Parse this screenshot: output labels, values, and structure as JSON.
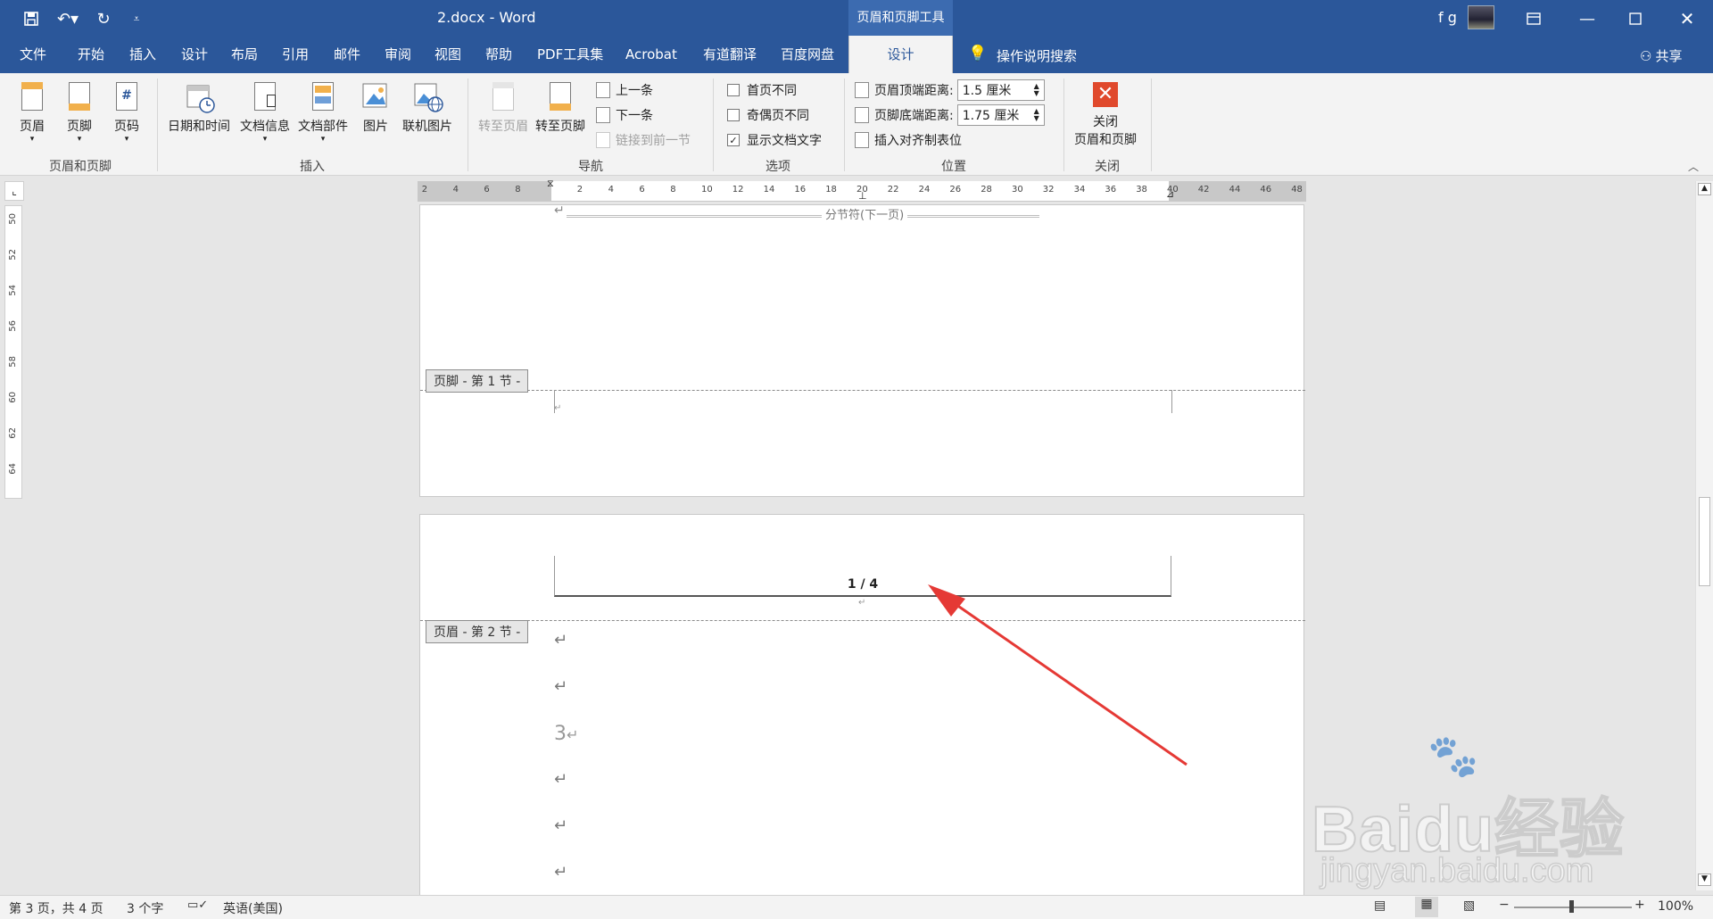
{
  "title": {
    "document": "2.docx  -  Word",
    "context_tab": "页眉和页脚工具",
    "user": "f g"
  },
  "menu": {
    "tabs": [
      "文件",
      "开始",
      "插入",
      "设计",
      "布局",
      "引用",
      "邮件",
      "审阅",
      "视图",
      "帮助",
      "PDF工具集",
      "Acrobat",
      "有道翻译",
      "百度网盘"
    ],
    "active_tab": "设计",
    "tell_me": "操作说明搜索",
    "share": "共享"
  },
  "ribbon": {
    "g1": {
      "label": "页眉和页脚",
      "b1": "页眉",
      "b2": "页脚",
      "b3": "页码"
    },
    "g2": {
      "label": "插入",
      "b1": "日期和时间",
      "b2": "文档信息",
      "b3": "文档部件",
      "b4": "图片",
      "b5": "联机图片"
    },
    "g3": {
      "label": "导航",
      "b1": "转至页眉",
      "b2": "转至页脚",
      "prev": "上一条",
      "next": "下一条",
      "link": "链接到前一节"
    },
    "g4": {
      "label": "选项",
      "o1": "首页不同",
      "o2": "奇偶页不同",
      "o3": "显示文档文字",
      "o3_checked": true
    },
    "g5": {
      "label": "位置",
      "top_label": "页眉顶端距离:",
      "top_value": "1.5 厘米",
      "bottom_label": "页脚底端距离:",
      "bottom_value": "1.75 厘米",
      "align_tab": "插入对齐制表位"
    },
    "g6": {
      "label": "关闭",
      "close_l1": "关闭",
      "close_l2": "页眉和页脚"
    }
  },
  "ruler": {
    "h_left": [
      "8",
      "6",
      "4",
      "2"
    ],
    "h_right": [
      "2",
      "4",
      "6",
      "8",
      "10",
      "12",
      "14",
      "16",
      "18",
      "20",
      "22",
      "24",
      "26",
      "28",
      "30",
      "32",
      "34",
      "36",
      "38",
      "40",
      "42",
      "44",
      "46",
      "48"
    ],
    "v": [
      "50",
      "52",
      "54",
      "56",
      "58",
      "60",
      "62",
      "64"
    ]
  },
  "document": {
    "section_break": "分节符(下一页)",
    "footer_label": "页脚 - 第 1 节 -",
    "header_label": "页眉 - 第 2 节 -",
    "page_number": "1 / 4",
    "body_digit": "3"
  },
  "watermark": {
    "brand": "Baidu经验",
    "url": "jingyan.baidu.com"
  },
  "status": {
    "page": "第 3 页，共 4 页",
    "words": "3 个字",
    "language": "英语(美国)",
    "zoom": "100%"
  },
  "colors": {
    "accent": "#2b579a",
    "arrow": "#e53935",
    "close": "#e0492c"
  }
}
